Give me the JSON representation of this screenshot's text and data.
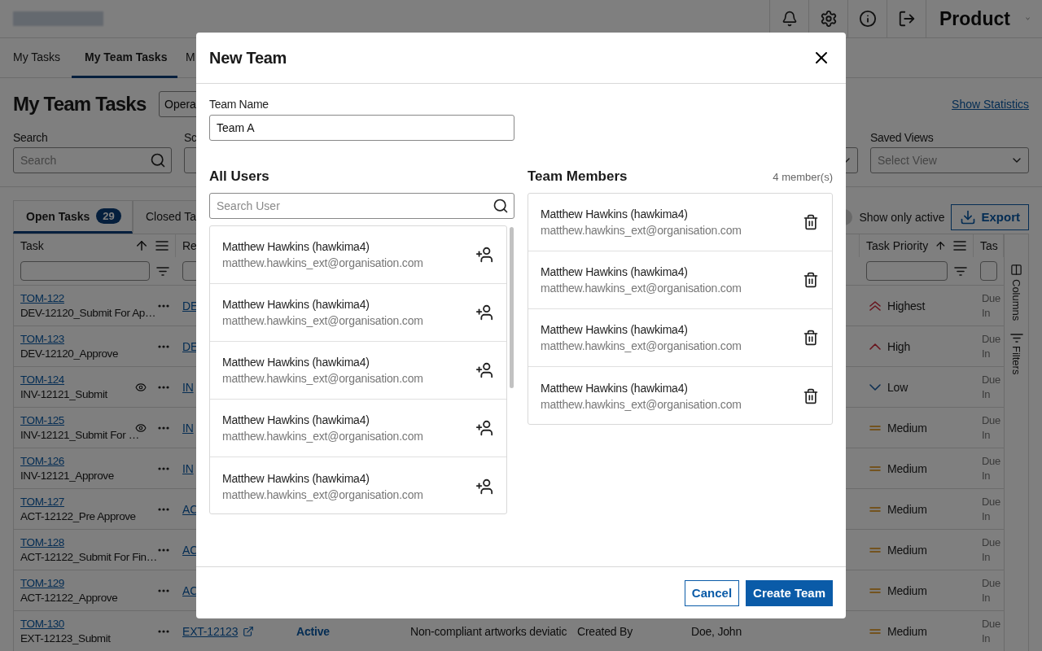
{
  "header": {
    "product": "Product"
  },
  "nav_tabs": [
    {
      "label": "My Tasks",
      "selected": false
    },
    {
      "label": "My Team Tasks",
      "selected": true
    },
    {
      "label": "M",
      "selected": false
    }
  ],
  "page_title": "My Team Tasks",
  "operation_select": {
    "value": "Opera"
  },
  "statistics_link": "Show Statistics",
  "filters": [
    {
      "kind": "search",
      "label": "Search",
      "placeholder": "Search"
    },
    {
      "kind": "select",
      "label": "Sc"
    }
  ],
  "saved_views": {
    "label": "Saved Views",
    "placeholder": "Select View"
  },
  "task_tabs": [
    {
      "label": "Open Tasks",
      "count": "29",
      "selected": true
    },
    {
      "label": "Closed Ta",
      "selected": false
    }
  ],
  "show_only_active": {
    "label": "Show only active",
    "on": false
  },
  "export_button": "Export",
  "table": {
    "columns": [
      {
        "label": "Task",
        "kind": "sortable"
      },
      {
        "label": "Re",
        "kind": "plain"
      },
      {
        "label": "Task Priority",
        "kind": "sortable"
      },
      {
        "label": "Tas",
        "kind": "plain"
      }
    ],
    "rows": [
      {
        "task_id": "TOM-122",
        "task_name": "DEV-12120_Submit For Ap…",
        "watched": false,
        "reference": "DE",
        "priority": {
          "kind": "highest",
          "label": "Highest"
        },
        "due": "Due In"
      },
      {
        "task_id": "TOM-123",
        "task_name": "DEV-12120_Approve",
        "watched": false,
        "reference": "DE",
        "priority": {
          "kind": "high",
          "label": "High"
        },
        "due": "Due In"
      },
      {
        "task_id": "TOM-124",
        "task_name": "INV-12121_Submit",
        "watched": true,
        "reference": "IN",
        "priority": {
          "kind": "low",
          "label": "Low"
        },
        "due": "Due In"
      },
      {
        "task_id": "TOM-125",
        "task_name": "INV-12121_Submit For …",
        "watched": true,
        "reference": "IN",
        "priority": {
          "kind": "medium",
          "label": "Medium"
        },
        "due": "Due In"
      },
      {
        "task_id": "TOM-126",
        "task_name": "INV-12121_Approve",
        "watched": false,
        "reference": "IN",
        "priority": {
          "kind": "medium",
          "label": "Medium"
        },
        "due": "Due In"
      },
      {
        "task_id": "TOM-127",
        "task_name": "ACT-12122_Pre Approve",
        "watched": false,
        "reference": "AC",
        "priority": {
          "kind": "medium",
          "label": "Medium"
        },
        "due": "Due In"
      },
      {
        "task_id": "TOM-128",
        "task_name": "ACT-12122_Submit For Fin…",
        "watched": false,
        "reference": "AC",
        "priority": {
          "kind": "medium",
          "label": "Medium"
        },
        "due": "Due In"
      },
      {
        "task_id": "TOM-129",
        "task_name": "ACT-12122_Approve",
        "watched": false,
        "reference": "AC",
        "priority": {
          "kind": "medium",
          "label": "Medium"
        },
        "due": "Due In"
      },
      {
        "task_id": "TOM-130",
        "task_name": "EXT-12123_Submit",
        "watched": false,
        "reference": "EXT-12123",
        "external": true,
        "status": "Active",
        "description": "Non-compliant artworks deviatic",
        "created": "Created By",
        "owner": "Doe, John",
        "priority": {
          "kind": "medium",
          "label": "Medium"
        },
        "due": "Due In"
      }
    ]
  },
  "side_panel": [
    {
      "kind": "columns",
      "label": "Columns"
    },
    {
      "kind": "filters",
      "label": "Filters"
    }
  ],
  "dialog": {
    "title": "New Team",
    "team_name": {
      "label": "Team Name",
      "value": "Team A"
    },
    "all_users": {
      "title": "All Users",
      "search_placeholder": "Search User",
      "users": [
        {
          "name": "Matthew Hawkins (hawkima4)",
          "email": "matthew.hawkins_ext@organisation.com"
        },
        {
          "name": "Matthew Hawkins (hawkima4)",
          "email": "matthew.hawkins_ext@organisation.com"
        },
        {
          "name": "Matthew Hawkins (hawkima4)",
          "email": "matthew.hawkins_ext@organisation.com"
        },
        {
          "name": "Matthew Hawkins (hawkima4)",
          "email": "matthew.hawkins_ext@organisation.com"
        },
        {
          "name": "Matthew Hawkins (hawkima4)",
          "email": "matthew.hawkins_ext@organisation.com"
        }
      ]
    },
    "team_members": {
      "title": "Team Members",
      "count": "4 member(s)",
      "members": [
        {
          "name": "Matthew Hawkins (hawkima4)",
          "email": "matthew.hawkins_ext@organisation.com"
        },
        {
          "name": "Matthew Hawkins (hawkima4)",
          "email": "matthew.hawkins_ext@organisation.com"
        },
        {
          "name": "Matthew Hawkins (hawkima4)",
          "email": "matthew.hawkins_ext@organisation.com"
        },
        {
          "name": "Matthew Hawkins (hawkima4)",
          "email": "matthew.hawkins_ext@organisation.com"
        }
      ]
    },
    "buttons": [
      {
        "label": "Cancel",
        "kind": "secondary"
      },
      {
        "label": "Create Team",
        "kind": "primary"
      }
    ]
  }
}
